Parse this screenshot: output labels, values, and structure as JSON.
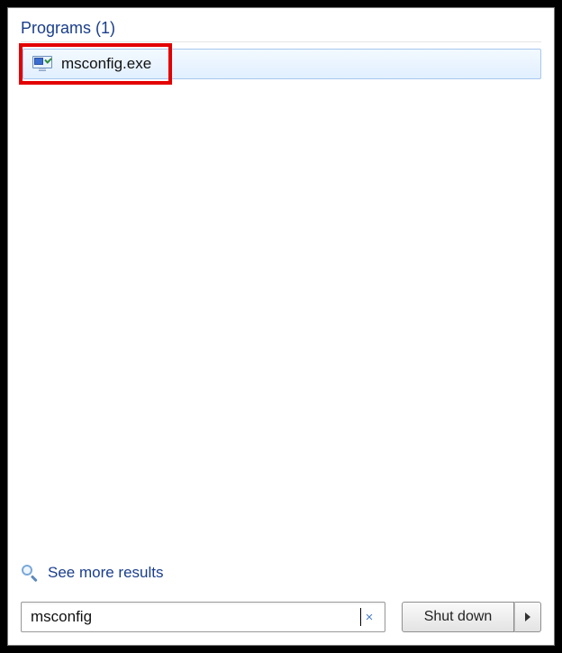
{
  "results": {
    "category_label": "Programs (1)",
    "items": [
      {
        "label": "msconfig.exe",
        "icon": "msconfig"
      }
    ]
  },
  "see_more_label": "See more results",
  "search": {
    "value": "msconfig",
    "clear_glyph": "×"
  },
  "shutdown": {
    "label": "Shut down"
  }
}
